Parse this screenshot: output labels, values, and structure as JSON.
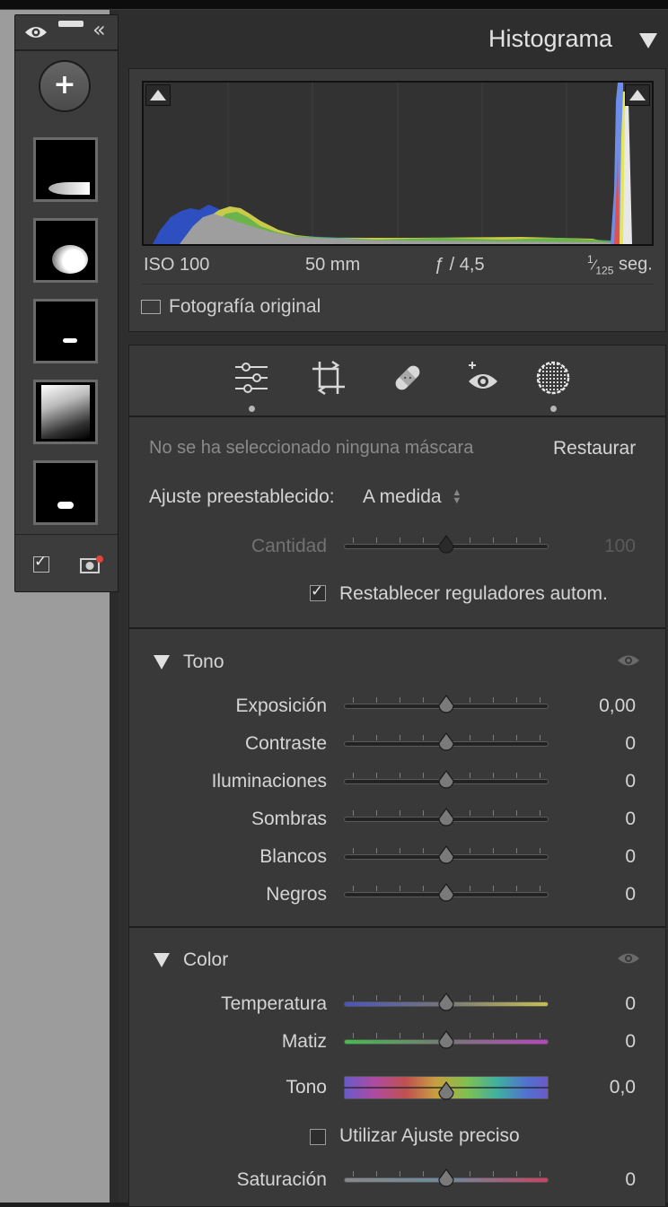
{
  "histogram": {
    "title": "Histograma",
    "exif": {
      "iso": "ISO 100",
      "focal": "50 mm",
      "aperture": "ƒ / 4,5",
      "shutter_num": "1",
      "shutter_den": "125",
      "shutter_unit": "seg."
    },
    "original_photo_label": "Fotografía original"
  },
  "tools": [
    "edit-sliders-icon",
    "crop-icon",
    "healing-icon",
    "redeye-icon",
    "masking-icon"
  ],
  "masking": {
    "status": "No se ha seleccionado ninguna máscara",
    "reset_label": "Restaurar",
    "preset_label": "Ajuste preestablecido:",
    "preset_value": "A medida",
    "amount_label": "Cantidad",
    "amount_value": "100",
    "auto_reset_label": "Restablecer reguladores autom."
  },
  "tono": {
    "title": "Tono",
    "sliders": [
      {
        "label": "Exposición",
        "value": "0,00"
      },
      {
        "label": "Contraste",
        "value": "0"
      },
      {
        "label": "Iluminaciones",
        "value": "0"
      },
      {
        "label": "Sombras",
        "value": "0"
      },
      {
        "label": "Blancos",
        "value": "0"
      },
      {
        "label": "Negros",
        "value": "0"
      }
    ]
  },
  "color": {
    "title": "Color",
    "temperature": {
      "label": "Temperatura",
      "value": "0"
    },
    "tint": {
      "label": "Matiz",
      "value": "0"
    },
    "hue": {
      "label": "Tono",
      "value": "0,0"
    },
    "fine_adjust_label": "Utilizar Ajuste preciso",
    "saturation": {
      "label": "Saturación",
      "value": "0"
    }
  },
  "colors": {
    "panel": "#393939",
    "text": "#d5d5d5",
    "temp_left": "#4a52c8",
    "temp_right": "#c8c04a",
    "tint_left": "#3ec04a",
    "tint_right": "#c040c8",
    "sat_right": "#d04060"
  }
}
